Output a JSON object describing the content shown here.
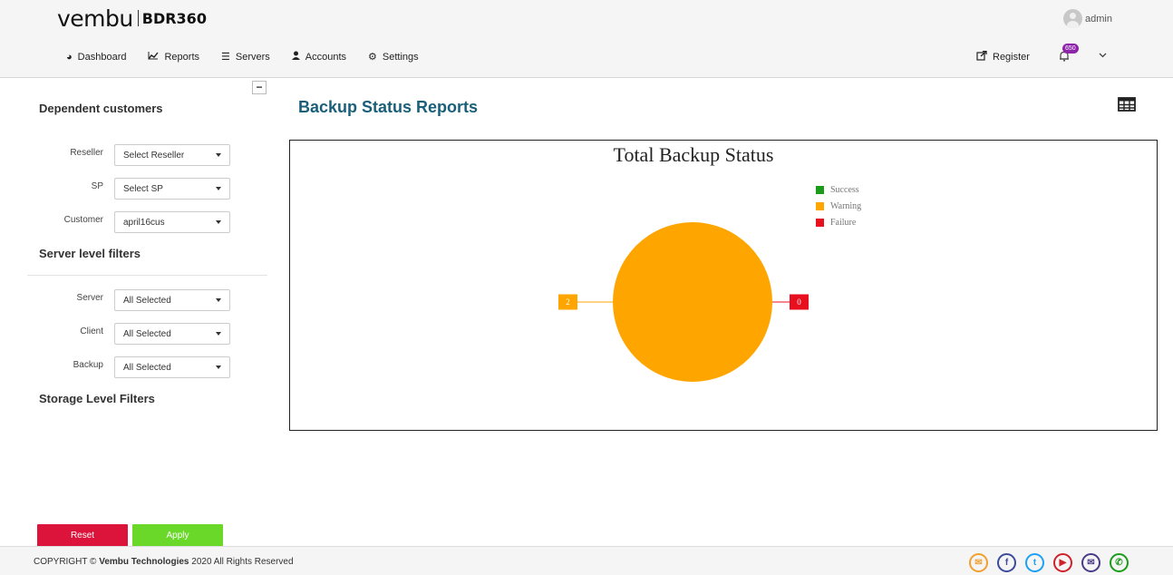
{
  "header": {
    "brand_name": "vembu",
    "product_name": "BDR360",
    "user_name": "admin",
    "notification_count": "650",
    "nav": [
      {
        "label": "Dashboard",
        "icon": "dashboard-icon"
      },
      {
        "label": "Reports",
        "icon": "chart-line-icon"
      },
      {
        "label": "Servers",
        "icon": "server-icon"
      },
      {
        "label": "Accounts",
        "icon": "user-icon"
      },
      {
        "label": "Settings",
        "icon": "gears-icon"
      }
    ],
    "register_label": "Register"
  },
  "sidebar": {
    "dependent_customers_title": "Dependent customers",
    "server_filters_title": "Server level filters",
    "storage_filters_title": "Storage Level Filters",
    "filters": {
      "reseller": {
        "label": "Reseller",
        "value": "Select Reseller"
      },
      "sp": {
        "label": "SP",
        "value": "Select SP"
      },
      "customer": {
        "label": "Customer",
        "value": "april16cus"
      },
      "server": {
        "label": "Server",
        "value": "All Selected"
      },
      "client": {
        "label": "Client",
        "value": "All Selected"
      },
      "backup": {
        "label": "Backup",
        "value": "All Selected"
      }
    },
    "reset_label": "Reset",
    "apply_label": "Apply"
  },
  "main": {
    "page_title": "Backup Status Reports"
  },
  "chart_data": {
    "type": "pie",
    "title": "Total Backup Status",
    "legend_position": "top-right",
    "categories": [
      "Success",
      "Warning",
      "Failure"
    ],
    "values": [
      0,
      2,
      0
    ],
    "colors": [
      "#1a9b1a",
      "#ffa500",
      "#e8101e"
    ],
    "data_labels": [
      {
        "category": "Warning",
        "text": "2",
        "color": "#ffa500"
      },
      {
        "category": "Failure",
        "text": "0",
        "color": "#e8101e"
      }
    ]
  },
  "footer": {
    "copyright_prefix": "COPYRIGHT ©",
    "company": "Vembu Technologies",
    "copyright_suffix": "2020 All Rights Reserved",
    "social": [
      {
        "icon": "chat-icon",
        "color": "#f0a030",
        "glyph": "✉"
      },
      {
        "icon": "facebook-icon",
        "color": "#3b4a9a",
        "glyph": "f"
      },
      {
        "icon": "twitter-icon",
        "color": "#1da1f2",
        "glyph": "t"
      },
      {
        "icon": "youtube-icon",
        "color": "#d0202a",
        "glyph": "▶"
      },
      {
        "icon": "email-icon",
        "color": "#4a3a8a",
        "glyph": "✉"
      },
      {
        "icon": "phone-icon",
        "color": "#1a9b1a",
        "glyph": "✆"
      }
    ]
  }
}
